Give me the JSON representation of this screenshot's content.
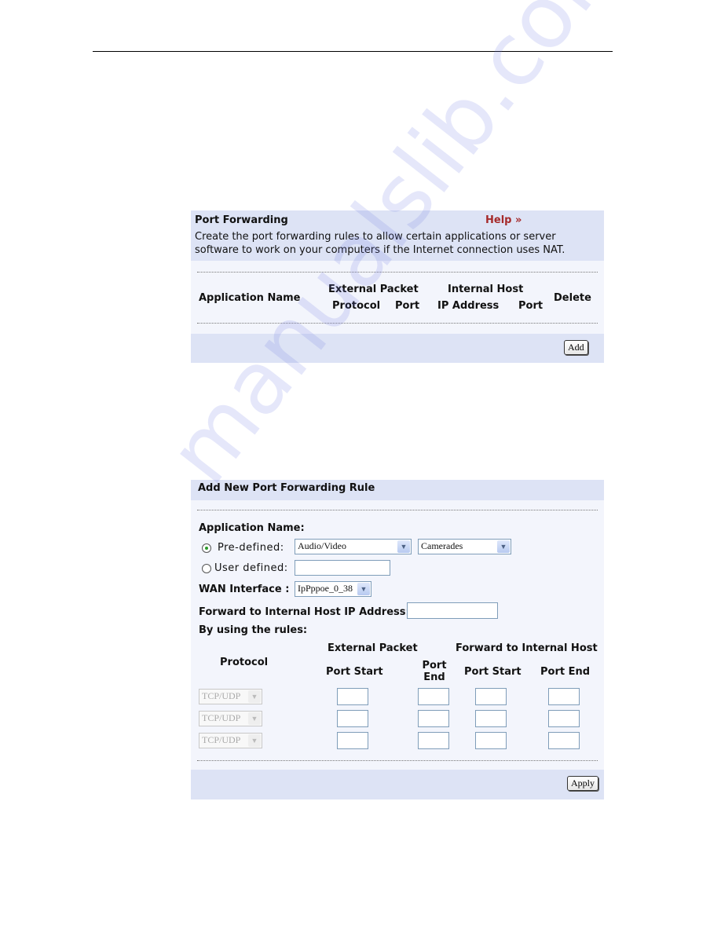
{
  "watermark": "manualslib.com",
  "port_forwarding": {
    "title": "Port Forwarding",
    "help": "Help",
    "help_icon": "double-chevron-right-icon",
    "description_line1": "Create the port forwarding rules to allow certain applications or server",
    "description_line2": "software to work on your computers if the Internet connection uses NAT.",
    "columns": {
      "application_name": "Application Name",
      "external_packet": "External Packet",
      "protocol": "Protocol",
      "port": "Port",
      "internal_host": "Internal Host",
      "ip_address": "IP Address",
      "internal_port": "Port",
      "delete": "Delete"
    },
    "add_label": "Add"
  },
  "add_rule": {
    "title": "Add New Port Forwarding Rule",
    "application_name_label": "Application Name:",
    "predefined_label": "Pre-defined:",
    "predefined_selected": true,
    "category_value": "Audio/Video",
    "application_value": "Camerades",
    "user_defined_label": "User defined:",
    "user_defined_value": "",
    "wan_interface_label": "WAN Interface :",
    "wan_interface_value": "IpPppoe_0_38",
    "internal_ip_label": "Forward to Internal Host IP Address:",
    "internal_ip_value": "",
    "rules_label": "By using the rules:",
    "columns": {
      "protocol": "Protocol",
      "external_packet": "External Packet",
      "ext_port_start": "Port Start",
      "ext_port_end_1": "Port",
      "ext_port_end_2": "End",
      "forward_internal": "Forward to Internal Host",
      "int_port_start": "Port Start",
      "int_port_end": "Port End"
    },
    "rows": [
      {
        "protocol": "TCP/UDP"
      },
      {
        "protocol": "TCP/UDP"
      },
      {
        "protocol": "TCP/UDP"
      }
    ],
    "apply_label": "Apply"
  }
}
